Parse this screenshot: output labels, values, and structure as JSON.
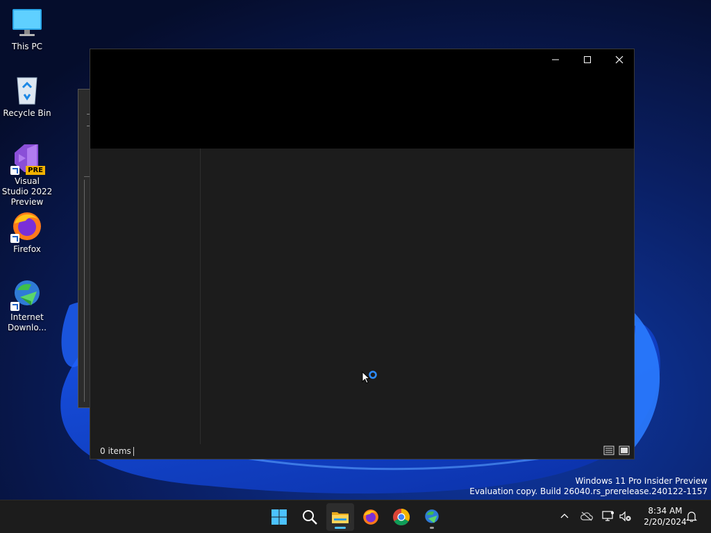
{
  "desktop": {
    "icons": [
      {
        "label": "This PC"
      },
      {
        "label": "Recycle Bin"
      },
      {
        "label": "Visual Studio 2022 Preview",
        "badge": "PRE"
      },
      {
        "label": "Firefox"
      },
      {
        "label": "Internet Downlo..."
      }
    ]
  },
  "explorer": {
    "status": {
      "item_count": "0 items"
    }
  },
  "watermark": {
    "line1": "Windows 11 Pro Insider Preview",
    "line2": "Evaluation copy. Build 26040.rs_prerelease.240122-1157"
  },
  "taskbar": {
    "clock": {
      "time": "8:34 AM",
      "date": "2/20/2024"
    }
  },
  "colors": {
    "accent": "#4cc2ff",
    "taskbar_bg": "#1c1c1c",
    "window_bg": "#1c1c1c",
    "desktop_bg": "#071540"
  },
  "icons": [
    "this-pc-icon",
    "recycle-bin-icon",
    "visual-studio-icon",
    "firefox-icon",
    "internet-download-manager-icon",
    "minimize-icon",
    "maximize-icon",
    "close-icon",
    "start-icon",
    "search-icon",
    "file-explorer-icon",
    "chrome-icon",
    "chevron-up-icon",
    "onedrive-icon",
    "network-icon",
    "volume-muted-icon",
    "bell-icon",
    "busy-cursor-icon"
  ]
}
